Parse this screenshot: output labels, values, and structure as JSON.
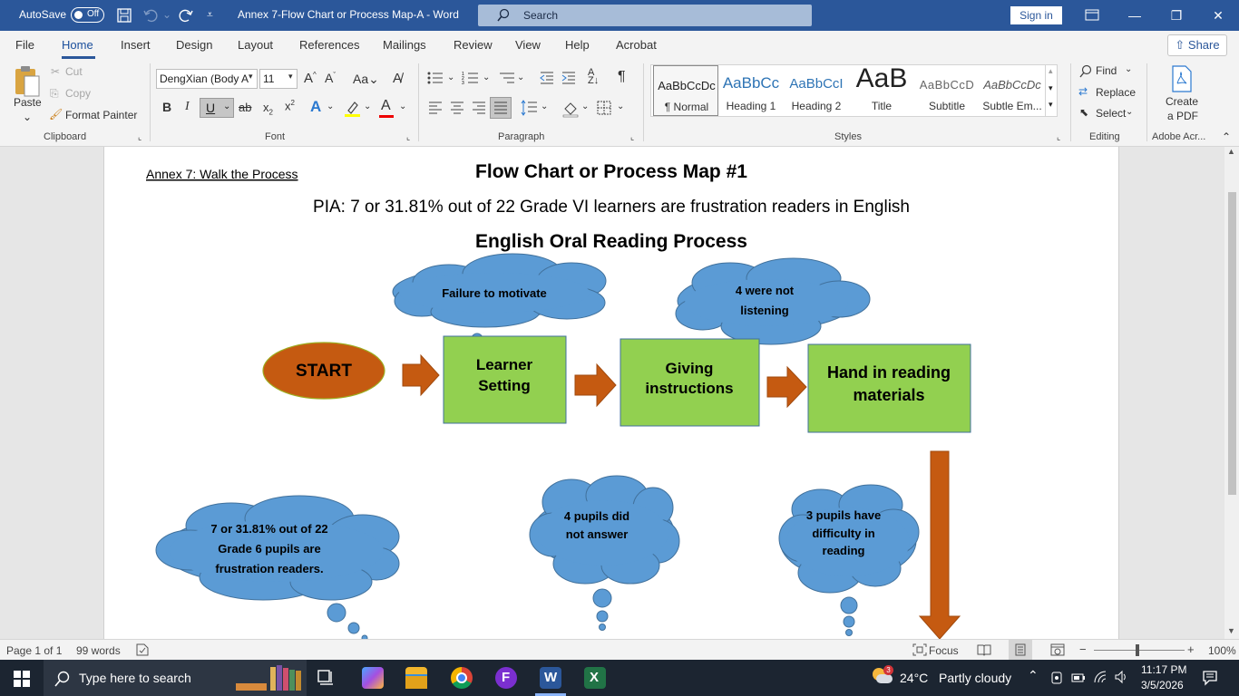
{
  "titlebar": {
    "autosave_label": "AutoSave",
    "autosave_state": "Off",
    "doc_title": "Annex 7-Flow Chart or Process Map-A  -  Word",
    "search_placeholder": "Search",
    "signin_label": "Sign in"
  },
  "menu": {
    "items": [
      "File",
      "Home",
      "Insert",
      "Design",
      "Layout",
      "References",
      "Mailings",
      "Review",
      "View",
      "Help",
      "Acrobat"
    ],
    "active": "Home",
    "share_label": "Share"
  },
  "ribbon": {
    "clipboard": {
      "paste": "Paste",
      "cut": "Cut",
      "copy": "Copy",
      "format_painter": "Format Painter",
      "label": "Clipboard"
    },
    "font": {
      "font_name": "DengXian (Body A",
      "font_size": "11",
      "label": "Font"
    },
    "paragraph": {
      "label": "Paragraph"
    },
    "styles": {
      "label": "Styles",
      "tiles": [
        {
          "preview": "AaBbCcDc",
          "name": "¶ Normal"
        },
        {
          "preview": "AaBbCc",
          "name": "Heading 1"
        },
        {
          "preview": "AaBbCcI",
          "name": "Heading 2"
        },
        {
          "preview": "AaB",
          "name": "Title"
        },
        {
          "preview": "AaBbCcD",
          "name": "Subtitle"
        },
        {
          "preview": "AaBbCcDc",
          "name": "Subtle Em..."
        }
      ]
    },
    "editing": {
      "find": "Find",
      "replace": "Replace",
      "select": "Select",
      "label": "Editing"
    },
    "acrobat": {
      "create": "Create",
      "pdf": "a PDF",
      "label": "Adobe Acr..."
    }
  },
  "document": {
    "annex_label": "Annex 7: Walk the Process",
    "heading": "Flow Chart or Process Map #1",
    "pia": "PIA:  7 or 31.81% out of 22 Grade VI learners are frustration readers in English",
    "process_title": "English Oral Reading Process",
    "start": "START",
    "steps": [
      "Learner",
      "Setting",
      "Giving",
      "instructions",
      "Hand in reading",
      "materials"
    ],
    "clouds": {
      "c1": [
        "Failure to motivate"
      ],
      "c2": [
        "4 were not",
        "listening"
      ],
      "c3": [
        "7 or 31.81% out of 22",
        "Grade 6 pupils are",
        "frustration readers."
      ],
      "c4": [
        "4 pupils did",
        "not answer"
      ],
      "c5": [
        "3 pupils have",
        "difficulty in",
        "reading"
      ]
    }
  },
  "status": {
    "page": "Page 1 of 1",
    "words": "99 words",
    "focus": "Focus",
    "zoom": "100%"
  },
  "taskbar": {
    "search_placeholder": "Type here to search",
    "weather_temp": "24°C",
    "weather_desc": "Partly cloudy",
    "weather_badge": "3",
    "time": "11:17 PM",
    "date": "3/5/2026"
  },
  "colors": {
    "word_blue": "#2b579a",
    "cloud_fill": "#5b9bd5",
    "box_fill": "#92d050",
    "arrow_fill": "#c55a11"
  }
}
